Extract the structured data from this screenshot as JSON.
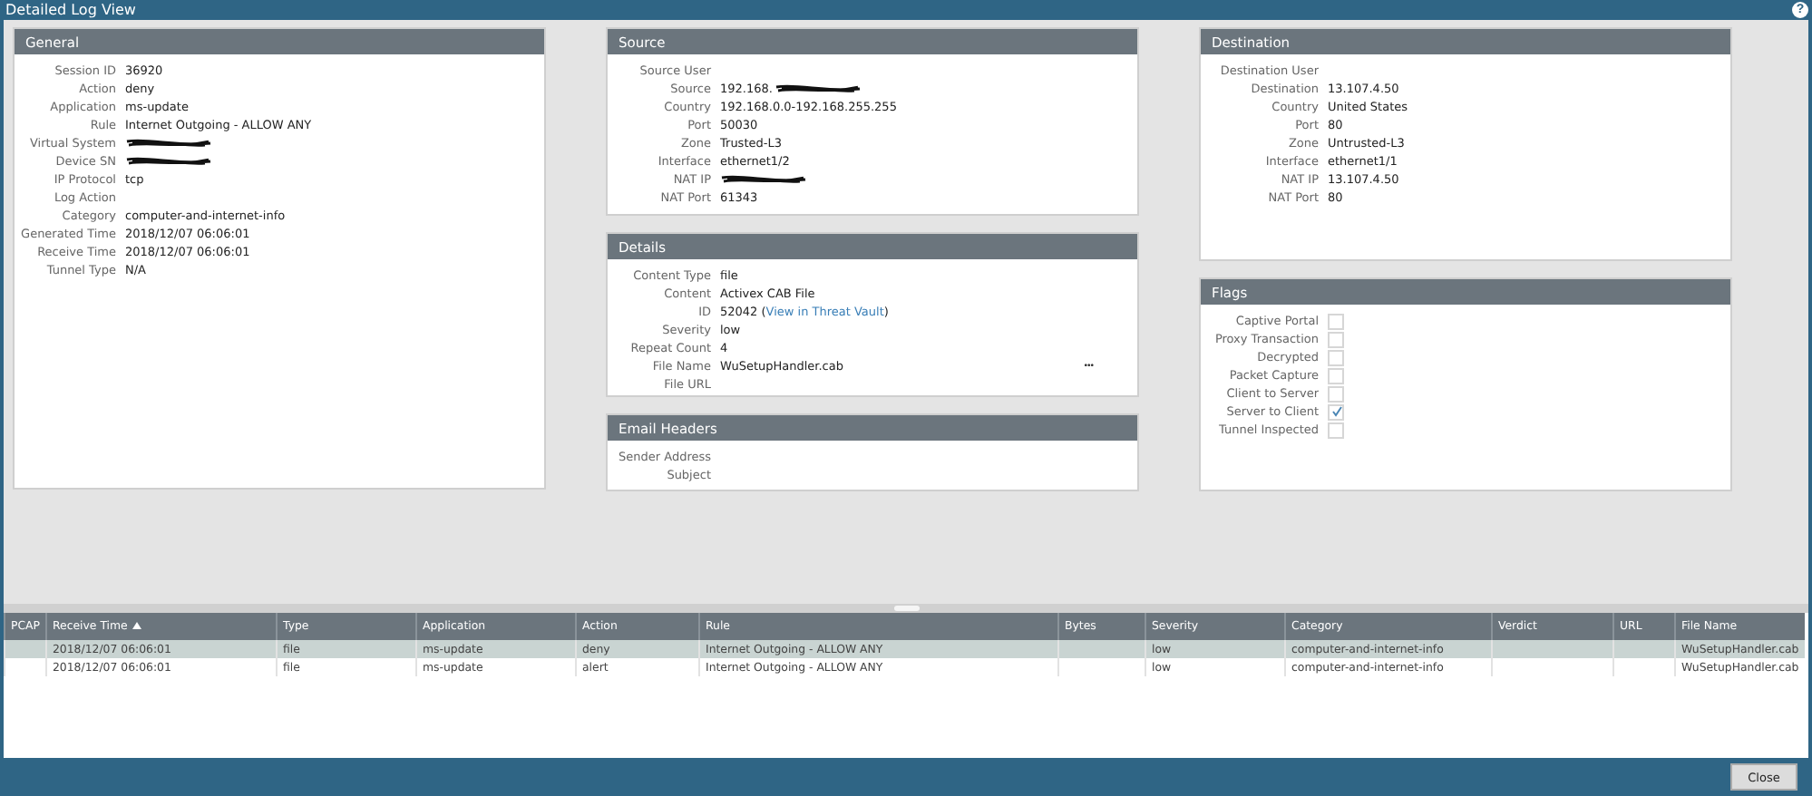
{
  "window": {
    "title": "Detailed Log View",
    "help": "?"
  },
  "columns": [
    [
      {
        "title": "General",
        "fields": [
          {
            "label": "Session ID",
            "value": "36920"
          },
          {
            "label": "Action",
            "value": "deny"
          },
          {
            "label": "Application",
            "value": "ms-update"
          },
          {
            "label": "Rule",
            "value": "Internet Outgoing - ALLOW ANY"
          },
          {
            "label": "Virtual System",
            "redacted": true
          },
          {
            "label": "Device SN",
            "redacted": true
          },
          {
            "label": "IP Protocol",
            "value": "tcp"
          },
          {
            "label": "Log Action"
          },
          {
            "label": "Category",
            "value": "computer-and-internet-info"
          },
          {
            "label": "Generated Time",
            "value": "2018/12/07 06:06:01"
          },
          {
            "label": "Receive Time",
            "value": "2018/12/07 06:06:01"
          },
          {
            "label": "Tunnel Type",
            "value": "N/A"
          }
        ]
      }
    ],
    [
      {
        "title": "Source",
        "fields": [
          {
            "label": "Source User"
          },
          {
            "label": "Source",
            "value": "192.168.",
            "redacted": true
          },
          {
            "label": "Country",
            "value": "192.168.0.0-192.168.255.255"
          },
          {
            "label": "Port",
            "value": "50030"
          },
          {
            "label": "Zone",
            "value": "Trusted-L3"
          },
          {
            "label": "Interface",
            "value": "ethernet1/2"
          },
          {
            "label": "NAT IP",
            "redacted": true
          },
          {
            "label": "NAT Port",
            "value": "61343"
          }
        ]
      },
      {
        "title": "Details",
        "fields": [
          {
            "label": "Content Type",
            "value": "file"
          },
          {
            "label": "Content",
            "value": "Activex CAB File"
          },
          {
            "label": "ID",
            "value": "52042 (",
            "link": "View in Threat Vault",
            "suffix": ")"
          },
          {
            "label": "Severity",
            "value": "low"
          },
          {
            "label": "Repeat Count",
            "value": "4"
          },
          {
            "label": "File Name",
            "value": "WuSetupHandler.cab",
            "more": "•••"
          },
          {
            "label": "File URL"
          }
        ]
      },
      {
        "title": "Email Headers",
        "fields": [
          {
            "label": "Sender Address"
          },
          {
            "label": "Subject"
          }
        ]
      }
    ],
    [
      {
        "title": "Destination",
        "fields": [
          {
            "label": "Destination User"
          },
          {
            "label": "Destination",
            "value": "13.107.4.50"
          },
          {
            "label": "Country",
            "value": "United States"
          },
          {
            "label": "Port",
            "value": "80"
          },
          {
            "label": "Zone",
            "value": "Untrusted-L3"
          },
          {
            "label": "Interface",
            "value": "ethernet1/1"
          },
          {
            "label": "NAT IP",
            "value": "13.107.4.50"
          },
          {
            "label": "NAT Port",
            "value": "80"
          }
        ]
      },
      {
        "title": "Flags",
        "flags": [
          {
            "label": "Captive Portal",
            "checked": false
          },
          {
            "label": "Proxy Transaction",
            "checked": false
          },
          {
            "label": "Decrypted",
            "checked": false
          },
          {
            "label": "Packet Capture",
            "checked": false
          },
          {
            "label": "Client to Server",
            "checked": false
          },
          {
            "label": "Server to Client",
            "checked": true
          },
          {
            "label": "Tunnel Inspected",
            "checked": false
          }
        ]
      }
    ]
  ],
  "table": {
    "columns": [
      {
        "label": "PCAP"
      },
      {
        "label": "Receive Time",
        "sorted": true
      },
      {
        "label": "Type"
      },
      {
        "label": "Application"
      },
      {
        "label": "Action"
      },
      {
        "label": "Rule"
      },
      {
        "label": "Bytes"
      },
      {
        "label": "Severity"
      },
      {
        "label": "Category"
      },
      {
        "label": "Verdict"
      },
      {
        "label": "URL"
      },
      {
        "label": "File Name"
      }
    ],
    "rows": [
      {
        "selected": true,
        "cells": [
          "",
          "2018/12/07 06:06:01",
          "file",
          "ms-update",
          "deny",
          "Internet Outgoing - ALLOW ANY",
          "",
          "low",
          "computer-and-internet-info",
          "",
          "",
          "WuSetupHandler.cab"
        ]
      },
      {
        "selected": false,
        "cells": [
          "",
          "2018/12/07 06:06:01",
          "file",
          "ms-update",
          "alert",
          "Internet Outgoing - ALLOW ANY",
          "",
          "low",
          "computer-and-internet-info",
          "",
          "",
          "WuSetupHandler.cab"
        ]
      }
    ]
  },
  "buttons": [
    {
      "label": "Close"
    }
  ]
}
